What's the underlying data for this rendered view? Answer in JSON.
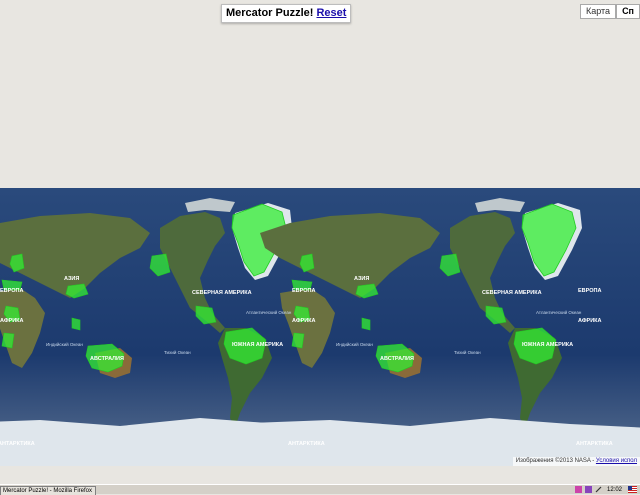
{
  "puzzle_box": {
    "title": "Mercator Puzzle!",
    "reset_label": "Reset"
  },
  "map_type": {
    "map_label": "Карта",
    "satellite_label": "Сп"
  },
  "map_labels": {
    "asia": "АЗИЯ",
    "europe": "ЕВРОПА",
    "africa": "АФРИКА",
    "north_america": "СЕВЕРНАЯ АМЕРИКА",
    "south_america": "ЮЖНАЯ АМЕРИКА",
    "australia": "АВСТРАЛИЯ",
    "antarctica": "АНТАРКТИКА",
    "atlantic": "Атлантический Океан",
    "pacific": "Тихий Океан",
    "indian": "Индийский Океан"
  },
  "attribution": {
    "text": "Изображения ©2013 NASA -",
    "link": "Условия испол"
  },
  "taskbar": {
    "window_title": "Mercator Puzzle! - Mozilla Firefox",
    "clock": "12:02"
  },
  "colors": {
    "ocean": "#1c3a6e",
    "land": "#4a6b3a",
    "piece": "#33ee33",
    "ice": "#dfe6ec"
  }
}
